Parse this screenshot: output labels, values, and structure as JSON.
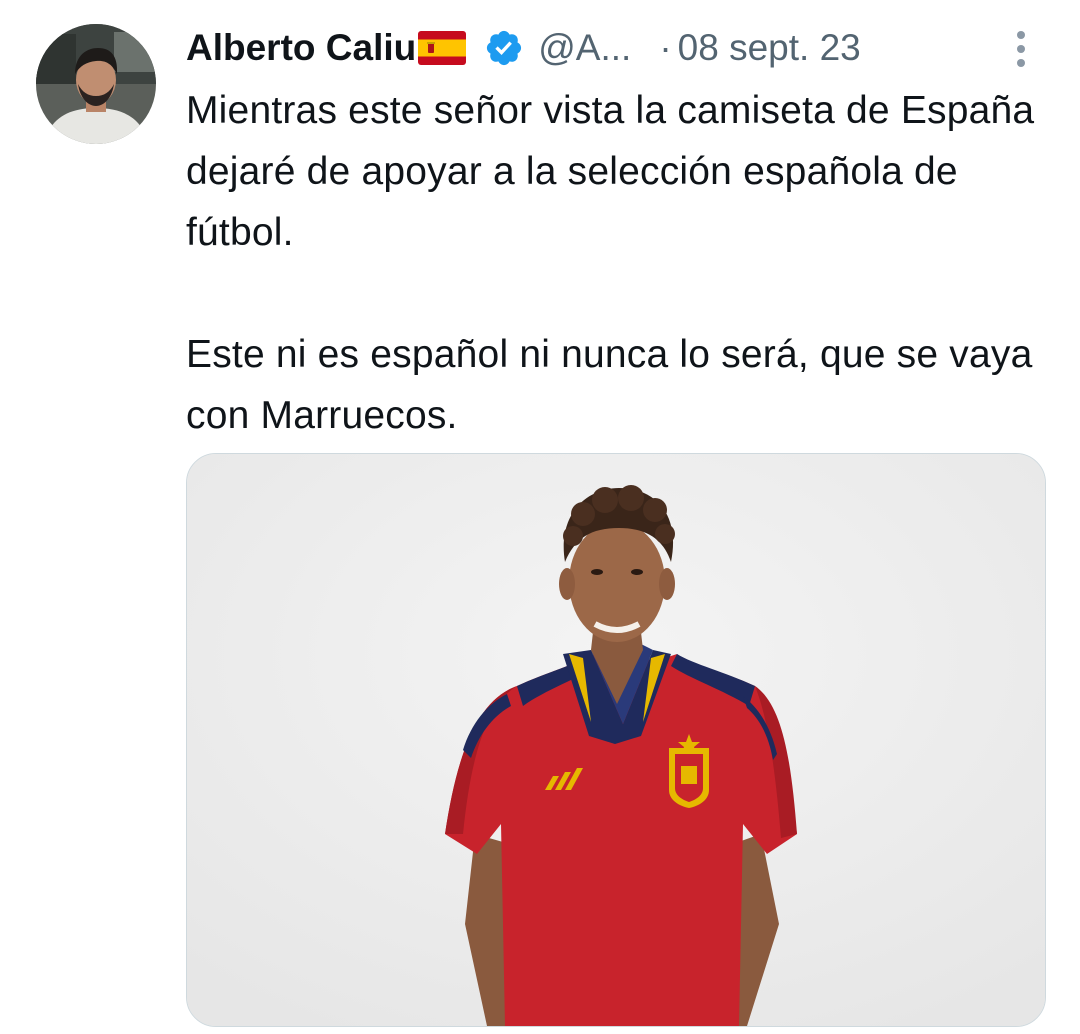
{
  "tweet": {
    "author": {
      "display_name": "Alberto Caliu",
      "flag_icon": "spain-flag-icon",
      "verified_icon": "verified-badge-icon",
      "verified_color": "#1d9bf0",
      "handle": "@A..."
    },
    "separator": "·",
    "date": "08 sept. 23",
    "more_icon": "more-options-icon",
    "text": {
      "paragraph_1": "Mientras este señor vista la camiseta de España dejaré de apoyar a la selección española de fútbol.",
      "paragraph_2": "Este ni es español ni nunca lo será, que se vaya con Marruecos."
    },
    "media": {
      "description_icon": "photo-player-red-jersey"
    }
  },
  "colors": {
    "text_primary": "#0f1419",
    "text_secondary": "#536471",
    "border": "#cfd9de",
    "jersey_red": "#c8232c",
    "jersey_navy": "#1f2a5c",
    "jersey_gold": "#e6b800"
  }
}
